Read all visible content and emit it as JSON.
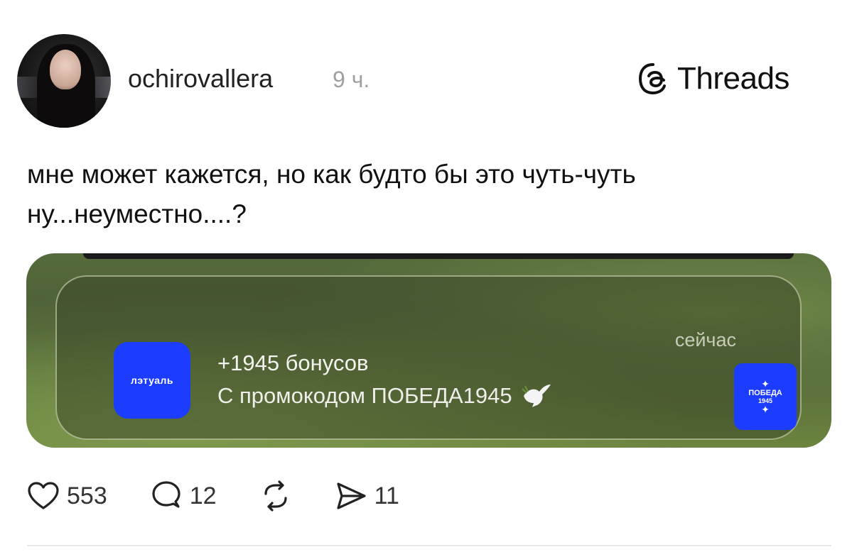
{
  "post": {
    "username": "ochirovallera",
    "time": "9 ч.",
    "brand": "Threads",
    "text": "мне может кажется, но как будто бы это чуть-чуть ну...неуместно....?"
  },
  "notification": {
    "app_icon_label": "лэтуаль",
    "title": "+1945 бонусов",
    "body": "С промокодом ПОБЕДА1945",
    "time": "сейчас",
    "promo_line1": "ПОБЕДА",
    "promo_line2": "1945",
    "accent_color": "#1c3cff"
  },
  "actions": {
    "likes": "553",
    "replies": "12",
    "shares": "11"
  }
}
